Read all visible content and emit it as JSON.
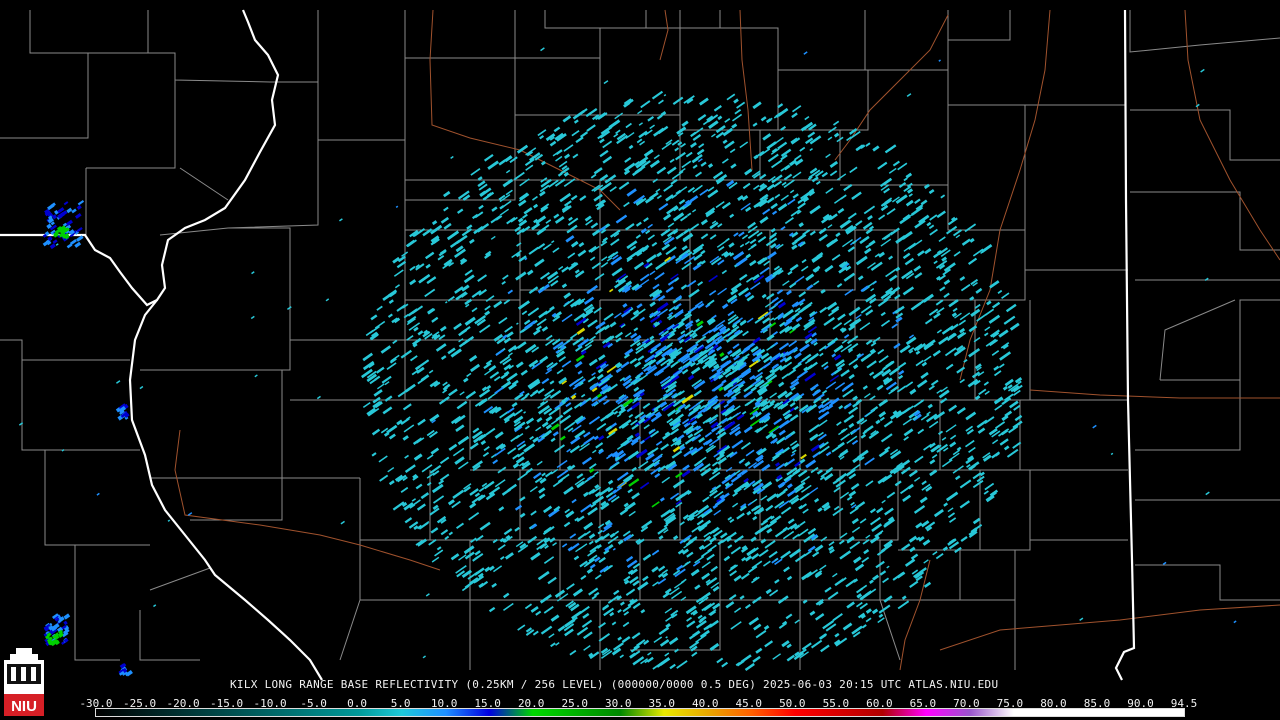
{
  "caption": {
    "text": "KILX LONG RANGE BASE REFLECTIVITY (0.25KM / 256 LEVEL) (000000/0000 0.5 DEG) 2025-06-03 20:15 UTC  ATLAS.NIU.EDU"
  },
  "logo": {
    "text": "NIU"
  },
  "scale": {
    "labels": [
      "-30.0",
      "-25.0",
      "-20.0",
      "-15.0",
      "-10.0",
      "-5.0",
      "0.0",
      "5.0",
      "10.0",
      "15.0",
      "20.0",
      "25.0",
      "30.0",
      "35.0",
      "40.0",
      "45.0",
      "50.0",
      "55.0",
      "60.0",
      "65.0",
      "70.0",
      "75.0",
      "80.0",
      "85.0",
      "90.0",
      "94.5"
    ],
    "colors": [
      {
        "value": -30,
        "color": "#000000"
      },
      {
        "value": 0,
        "color": "#009999"
      },
      {
        "value": 5,
        "color": "#1ec8d8"
      },
      {
        "value": 10,
        "color": "#1e90ff"
      },
      {
        "value": 15,
        "color": "#0000e0"
      },
      {
        "value": 20,
        "color": "#00d800"
      },
      {
        "value": 30,
        "color": "#008800"
      },
      {
        "value": 35,
        "color": "#e8e800"
      },
      {
        "value": 40,
        "color": "#e8a800"
      },
      {
        "value": 45,
        "color": "#ff6000"
      },
      {
        "value": 50,
        "color": "#ff0000"
      },
      {
        "value": 60,
        "color": "#b00000"
      },
      {
        "value": 65,
        "color": "#ff00ff"
      },
      {
        "value": 70,
        "color": "#9955cc"
      },
      {
        "value": 75,
        "color": "#ffffff"
      },
      {
        "value": 94.5,
        "color": "#ffffff"
      }
    ]
  },
  "map": {
    "background": "#000000",
    "county_line_color": "#8a8a8a",
    "state_line_color": "#ffffff",
    "highway_color": "#a0522d",
    "echo_colors": {
      "light": "#28c8d8",
      "medium": "#1e90ff",
      "strong": "#0000d0",
      "green": "#00d000",
      "yellow": "#d8d800"
    }
  }
}
